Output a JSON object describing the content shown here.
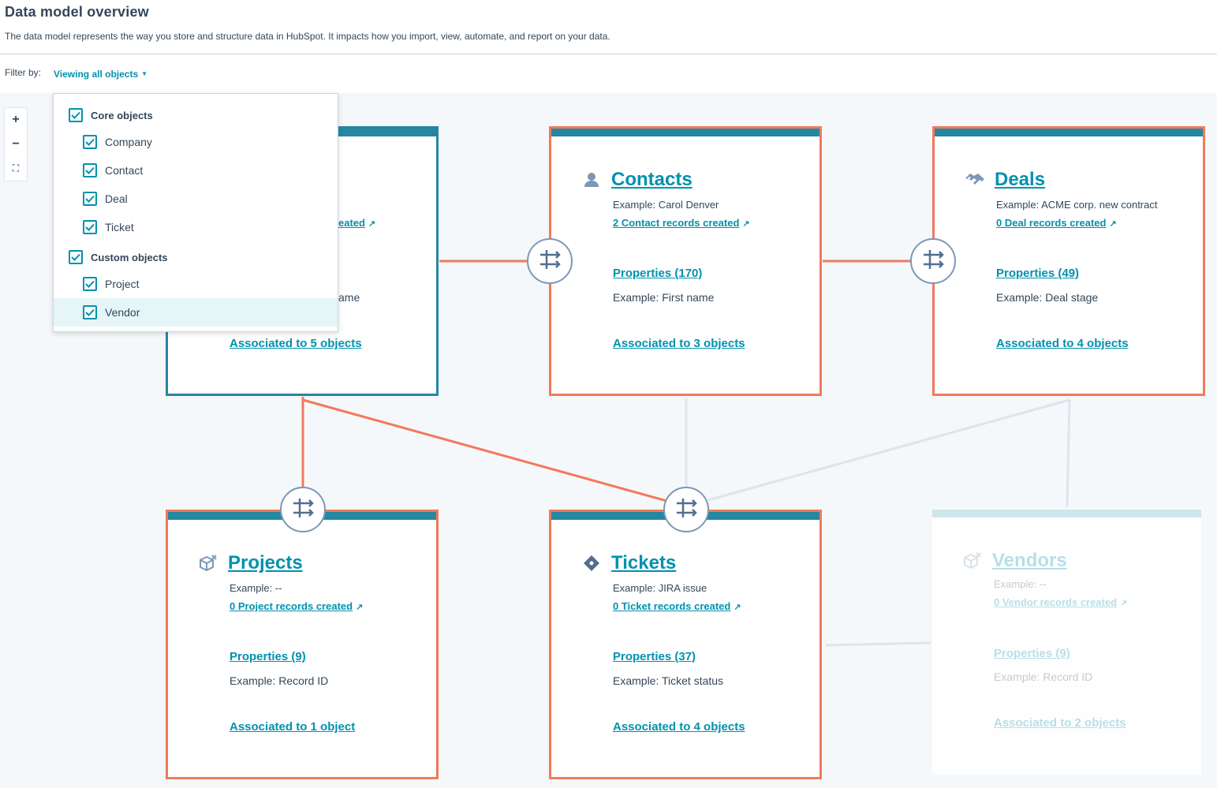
{
  "header": {
    "title": "Data model overview",
    "description": "The data model represents the way you store and structure data in HubSpot. It impacts how you import, view, automate, and report on your data."
  },
  "filter": {
    "label": "Filter by:",
    "value": "Viewing all objects"
  },
  "zoom": {
    "in": "+",
    "out": "−",
    "fit": "⛶"
  },
  "dropdown": {
    "groups": [
      {
        "label": "Core objects",
        "checked": true,
        "items": [
          {
            "label": "Company",
            "checked": true
          },
          {
            "label": "Contact",
            "checked": true
          },
          {
            "label": "Deal",
            "checked": true
          },
          {
            "label": "Ticket",
            "checked": true
          }
        ]
      },
      {
        "label": "Custom objects",
        "checked": true,
        "items": [
          {
            "label": "Project",
            "checked": true
          },
          {
            "label": "Vendor",
            "checked": true,
            "highlighted": true
          }
        ]
      }
    ]
  },
  "cards": {
    "companies": {
      "records_fragment": "eated",
      "property_fragment": "ame",
      "associated": "Associated to 5 objects"
    },
    "contacts": {
      "title": "Contacts",
      "example": "Example: Carol Denver",
      "records": "2 Contact records created",
      "properties": "Properties (170)",
      "property_example": "Example: First name",
      "associated": "Associated to 3 objects"
    },
    "deals": {
      "title": "Deals",
      "example": "Example: ACME corp. new contract",
      "records": "0 Deal records created",
      "properties": "Properties (49)",
      "property_example": "Example: Deal stage",
      "associated": "Associated to 4 objects"
    },
    "projects": {
      "title": "Projects",
      "example": "Example: --",
      "records": "0 Project records created",
      "properties": "Properties (9)",
      "property_example": "Example: Record ID",
      "associated": "Associated to 1 object"
    },
    "tickets": {
      "title": "Tickets",
      "example": "Example: JIRA issue",
      "records": "0 Ticket records created",
      "properties": "Properties (37)",
      "property_example": "Example: Ticket status",
      "associated": "Associated to 4 objects"
    },
    "vendors": {
      "title": "Vendors",
      "example": "Example: --",
      "records": "0 Vendor records created",
      "properties": "Properties (9)",
      "property_example": "Example: Record ID",
      "associated": "Associated to 2 objects"
    }
  },
  "colors": {
    "accent": "#0091ae",
    "active_link": "#f2795a",
    "inactive_link": "#dfe3eb",
    "card_bar": "#2587a0"
  },
  "icons": {
    "contacts": "person-icon",
    "deals": "handshake-icon",
    "projects": "cube-icon",
    "tickets": "ticket-icon",
    "vendors": "cube-icon",
    "hub": "association-icon"
  }
}
